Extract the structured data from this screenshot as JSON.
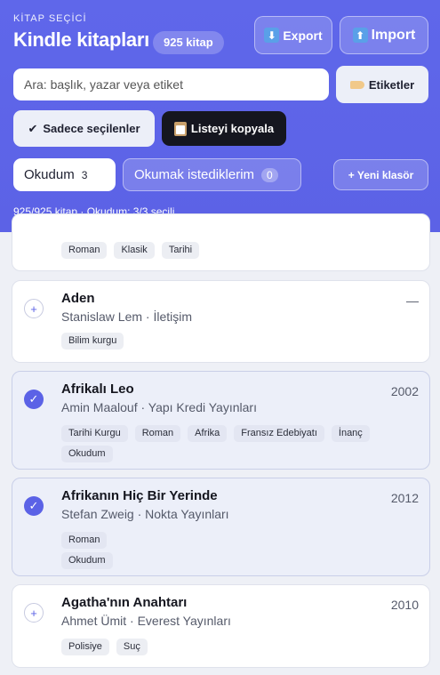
{
  "header": {
    "eyebrow": "KİTAP SEÇİCİ",
    "title": "Kindle kitapları",
    "count_badge": "925 kitap",
    "export_label": "Export",
    "import_label": "Import",
    "export_icon": "down-arrow-icon",
    "import_icon": "up-arrow-icon"
  },
  "search": {
    "placeholder": "Ara: başlık, yazar veya etiket",
    "value": ""
  },
  "toolbar": {
    "tags_label": "Etiketler",
    "selected_only_label": "Sadece seçilenler",
    "copy_list_label": "Listeyi kopyala",
    "check_glyph": "✔"
  },
  "folders": {
    "active": {
      "label": "Okudum",
      "count": "3"
    },
    "inactive": {
      "label": "Okumak istediklerim",
      "count": "0"
    },
    "new_label": "+ Yeni klasör"
  },
  "status": "925/925 kitap · Okudum: 3/3 seçili",
  "books": [
    {
      "title": "",
      "subtitle": "",
      "year": "",
      "selected": false,
      "tags": [
        "Roman",
        "Klasik",
        "Tarihi"
      ],
      "folder_tags": []
    },
    {
      "title": "Aden",
      "subtitle": "Stanislaw Lem · İletişim",
      "year": "—",
      "selected": false,
      "tags": [
        "Bilim kurgu"
      ],
      "folder_tags": []
    },
    {
      "title": "Afrikalı Leo",
      "subtitle": "Amin Maalouf · Yapı Kredi Yayınları",
      "year": "2002",
      "selected": true,
      "tags": [
        "Tarihi Kurgu",
        "Roman",
        "Afrika",
        "Fransız Edebiyatı",
        "İnanç"
      ],
      "folder_tags": [
        "Okudum"
      ]
    },
    {
      "title": "Afrikanın Hiç Bir Yerinde",
      "subtitle": "Stefan Zweig · Nokta Yayınları",
      "year": "2012",
      "selected": true,
      "tags": [
        "Roman"
      ],
      "folder_tags": [
        "Okudum"
      ]
    },
    {
      "title": "Agatha'nın Anahtarı",
      "subtitle": "Ahmet Ümit · Everest Yayınları",
      "year": "2010",
      "selected": false,
      "tags": [
        "Polisiye",
        "Suç"
      ],
      "folder_tags": []
    }
  ],
  "glyphs": {
    "unchecked": "+",
    "checked": "✓"
  },
  "colors": {
    "accent": "#5c63e8",
    "dark_button": "#15161f",
    "selected_card": "#eceff9"
  }
}
